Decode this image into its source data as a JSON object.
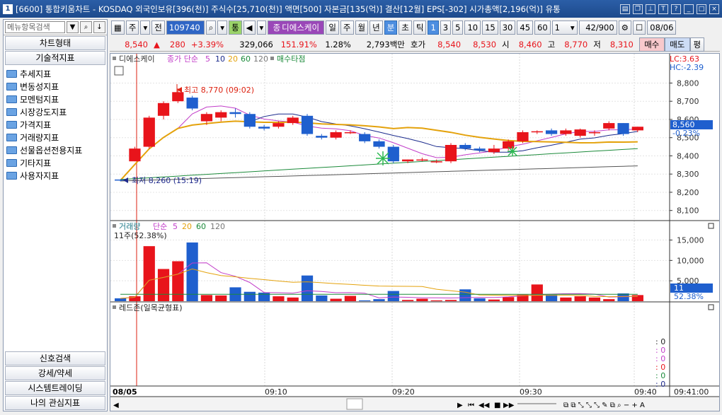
{
  "window": {
    "number": "1",
    "title": "[6600] 통합키움차트 - KOSDAQ 외국인보유[396(천)] 주식수[25,710(천)] 액면[500] 자본금[135(억)] 결산[12월] EPS[-302] 시가총액[2,196(억)] 유통"
  },
  "sidebar": {
    "search_placeholder": "메뉴항목검색",
    "top_buttons": [
      "차트형태",
      "기술적지표"
    ],
    "folders": [
      "추세지표",
      "변동성지표",
      "모멘텀지표",
      "시장강도지표",
      "가격지표",
      "거래량지표",
      "선물옵션전용지표",
      "기타지표",
      "사용자지표"
    ],
    "bottom_buttons": [
      "신호검색",
      "강세/약세",
      "시스템트레이딩",
      "나의 관심지표"
    ]
  },
  "toolbar": {
    "stock_code": "109740",
    "stock_name": "디에스케이",
    "period_tabs": [
      "일",
      "주",
      "월",
      "년",
      "분",
      "초",
      "틱"
    ],
    "selected_period": "분",
    "minute_options": [
      "1",
      "3",
      "5",
      "10",
      "15",
      "30",
      "45",
      "60"
    ],
    "selected_minute": "1",
    "count": "1",
    "range": "42/900",
    "date": "08/06",
    "label_ju": "주",
    "label_jeon": "전",
    "label_tong": "통",
    "label_jong": "종"
  },
  "quote": {
    "price": "8,540",
    "change": "280",
    "change_pct": "+3.39%",
    "volume": "329,066",
    "vol_ratio": "151.91%",
    "turnover": "1.28%",
    "amount": "2,793백만",
    "hoga_label": "호가",
    "ask": "8,540",
    "bid": "8,530",
    "open_label": "시",
    "open": "8,460",
    "high_label": "고",
    "high": "8,770",
    "low_label": "저",
    "low": "8,310",
    "buy_label": "매수",
    "sell_label": "매도",
    "eval_label": "평"
  },
  "price_panel": {
    "legend_name": "디에스케이",
    "legend_ma_label": "종가 단순",
    "ma_periods": [
      "5",
      "10",
      "20",
      "60",
      "120"
    ],
    "signal_label": "매수타점",
    "lc_label": "LC:3.63",
    "hc_label": "HC:-2.39",
    "current_price": "8,560",
    "current_change": "-0.23%",
    "high_annotation": "최고 8,770 (09:02)",
    "low_annotation": "최저 8,260 (15:19)",
    "y_ticks": [
      "8,800",
      "8,700",
      "8,600",
      "8,500",
      "8,400",
      "8,300",
      "8,200",
      "8,100"
    ]
  },
  "volume_panel": {
    "legend_name": "거래량",
    "legend_ma_label": "단순",
    "ma_periods": [
      "5",
      "20",
      "60",
      "120"
    ],
    "unit_note": "11주(52.38%)",
    "current": "11",
    "current_pct": "52.38%",
    "y_ticks": [
      "15,000",
      "10,000",
      "5,000"
    ]
  },
  "redzone_panel": {
    "legend_name": "레드존(일목균형표)",
    "values": [
      ": 0",
      ": 0",
      ": 0",
      ": 0",
      ": 0",
      ": 0"
    ]
  },
  "time_axis": {
    "labels": [
      "08/05",
      "09:10",
      "09:20",
      "09:30",
      "09:40"
    ],
    "current_time": "09:41:00"
  },
  "colors": {
    "up": "#e8141b",
    "down": "#1f5fce",
    "ma5": "#c23ec9",
    "ma10": "#1a2a8c",
    "ma20": "#e4a20c",
    "ma60": "#1b8a3a",
    "ma120": "#555555"
  },
  "chart_data": {
    "type": "candlestick",
    "interval": "1min",
    "candles": [
      {
        "o": 8270,
        "h": 8270,
        "l": 8260,
        "c": 8265
      },
      {
        "o": 8370,
        "h": 8450,
        "l": 8370,
        "c": 8440
      },
      {
        "o": 8450,
        "h": 8620,
        "l": 8440,
        "c": 8610
      },
      {
        "o": 8620,
        "h": 8700,
        "l": 8600,
        "c": 8690
      },
      {
        "o": 8700,
        "h": 8770,
        "l": 8690,
        "c": 8750
      },
      {
        "o": 8720,
        "h": 8730,
        "l": 8650,
        "c": 8660
      },
      {
        "o": 8590,
        "h": 8640,
        "l": 8570,
        "c": 8630
      },
      {
        "o": 8610,
        "h": 8650,
        "l": 8590,
        "c": 8640
      },
      {
        "o": 8640,
        "h": 8660,
        "l": 8610,
        "c": 8630
      },
      {
        "o": 8630,
        "h": 8640,
        "l": 8550,
        "c": 8560
      },
      {
        "o": 8560,
        "h": 8570,
        "l": 8540,
        "c": 8550
      },
      {
        "o": 8560,
        "h": 8590,
        "l": 8550,
        "c": 8580
      },
      {
        "o": 8580,
        "h": 8620,
        "l": 8570,
        "c": 8610
      },
      {
        "o": 8620,
        "h": 8630,
        "l": 8510,
        "c": 8520
      },
      {
        "o": 8510,
        "h": 8520,
        "l": 8490,
        "c": 8500
      },
      {
        "o": 8500,
        "h": 8540,
        "l": 8490,
        "c": 8530
      },
      {
        "o": 8530,
        "h": 8540,
        "l": 8520,
        "c": 8530
      },
      {
        "o": 8520,
        "h": 8530,
        "l": 8470,
        "c": 8480
      },
      {
        "o": 8480,
        "h": 8490,
        "l": 8440,
        "c": 8450
      },
      {
        "o": 8450,
        "h": 8460,
        "l": 8360,
        "c": 8370
      },
      {
        "o": 8370,
        "h": 8380,
        "l": 8360,
        "c": 8380
      },
      {
        "o": 8380,
        "h": 8390,
        "l": 8370,
        "c": 8380
      },
      {
        "o": 8370,
        "h": 8380,
        "l": 8360,
        "c": 8370
      },
      {
        "o": 8370,
        "h": 8470,
        "l": 8360,
        "c": 8460
      },
      {
        "o": 8460,
        "h": 8470,
        "l": 8430,
        "c": 8440
      },
      {
        "o": 8440,
        "h": 8450,
        "l": 8420,
        "c": 8430
      },
      {
        "o": 8420,
        "h": 8460,
        "l": 8410,
        "c": 8440
      },
      {
        "o": 8440,
        "h": 8490,
        "l": 8430,
        "c": 8480
      },
      {
        "o": 8480,
        "h": 8540,
        "l": 8470,
        "c": 8530
      },
      {
        "o": 8530,
        "h": 8540,
        "l": 8520,
        "c": 8535
      },
      {
        "o": 8540,
        "h": 8550,
        "l": 8510,
        "c": 8520
      },
      {
        "o": 8520,
        "h": 8550,
        "l": 8510,
        "c": 8540
      },
      {
        "o": 8510,
        "h": 8550,
        "l": 8500,
        "c": 8545
      },
      {
        "o": 8530,
        "h": 8540,
        "l": 8510,
        "c": 8530
      },
      {
        "o": 8550,
        "h": 8590,
        "l": 8540,
        "c": 8580
      },
      {
        "o": 8580,
        "h": 8580,
        "l": 8510,
        "c": 8520
      },
      {
        "o": 8540,
        "h": 8560,
        "l": 8530,
        "c": 8560
      }
    ],
    "volume": [
      700,
      1200,
      13500,
      7900,
      9800,
      14400,
      1500,
      1400,
      3400,
      2300,
      2100,
      1200,
      900,
      6300,
      1400,
      600,
      1300,
      200,
      500,
      2500,
      300,
      600,
      200,
      300,
      2900,
      700,
      400,
      1000,
      1600,
      4100,
      1600,
      900,
      1200,
      900,
      500,
      1900,
      1500
    ],
    "ylim": [
      8060,
      8860
    ],
    "vol_ylim": [
      0,
      17000
    ]
  }
}
